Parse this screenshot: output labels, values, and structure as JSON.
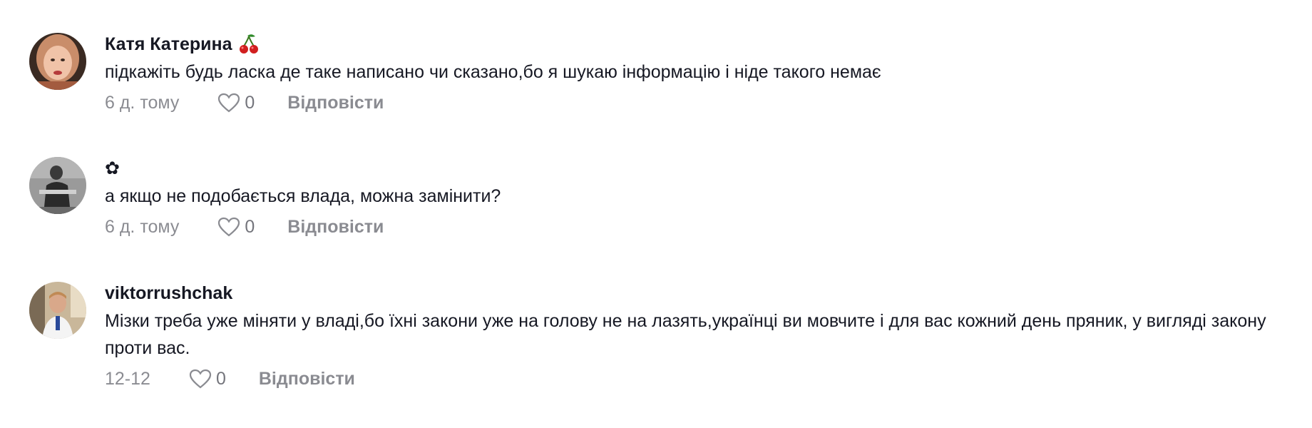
{
  "comments": [
    {
      "username": "Катя Катерина",
      "username_emoji": "cherries-emoji",
      "text": "підкажіть будь ласка де таке написано чи сказано,бо я шукаю інформацію і ніде такого немає",
      "date": "6 д. тому",
      "likes": "0",
      "reply_label": "Відповісти"
    },
    {
      "username": "✿",
      "text": "а якщо не подобається влада, можна замінити?",
      "date": "6 д. тому",
      "likes": "0",
      "reply_label": "Відповісти"
    },
    {
      "username": "viktorrushchak",
      "text": "Мізки треба уже міняти у владі,бо їхні закони уже на голову не на лазять,українці ви мовчите і для вас кожний день пряник, у вигляді закону проти вас.",
      "date": "12-12",
      "likes": "0",
      "reply_label": "Відповісти"
    }
  ],
  "colors": {
    "text_primary": "#161823",
    "text_secondary": "#8a8b91"
  }
}
